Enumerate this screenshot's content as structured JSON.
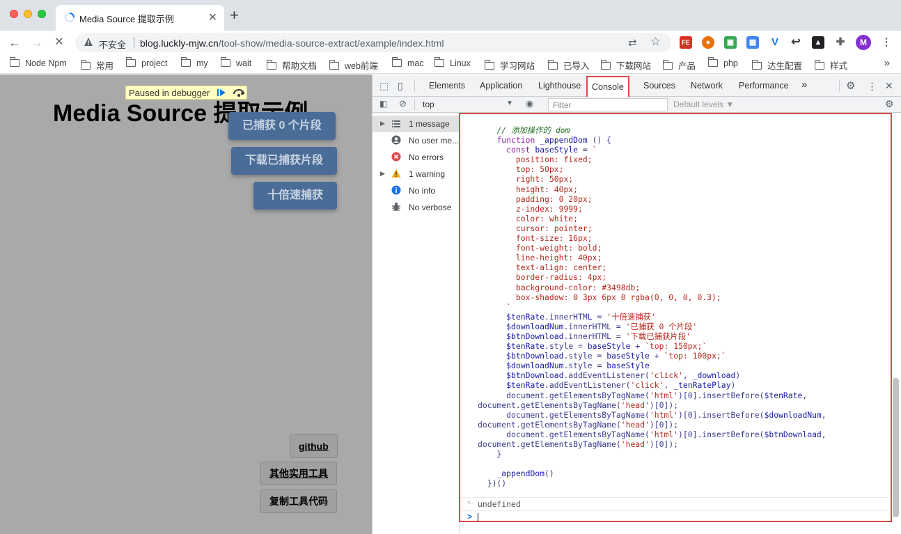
{
  "browser": {
    "tab_title": "Media Source 提取示例",
    "insecure_label": "不安全",
    "url_host": "blog.luckly-mjw.cn",
    "url_path": "/tool-show/media-source-extract/example/index.html",
    "profile_initial": "M",
    "extension_ie_label": "FE",
    "bookmarks": [
      "Node Npm",
      "常用",
      "project",
      "my",
      "wait",
      "帮助文档",
      "web前端",
      "mac",
      "Linux",
      "学习网站",
      "已导入",
      "下载网站",
      "产品",
      "php",
      "达生配置",
      "样式"
    ]
  },
  "page": {
    "paused_label": "Paused in debugger",
    "title": "Media Source 提取示例",
    "buttons": {
      "captured": "已捕获 0 个片段",
      "download": "下载已捕获片段",
      "ten_rate": "十倍速捕获"
    },
    "links": {
      "github": "github",
      "other_tools": "其他实用工具",
      "copy_code": "复制工具代码"
    },
    "accent_color": "#4a6d98"
  },
  "devtools": {
    "tabs": [
      "Elements",
      "Application",
      "Lighthouse",
      "Console",
      "Sources",
      "Network",
      "Performance"
    ],
    "active_tab": "Console",
    "more_tabs": "»",
    "context": "top",
    "filter_placeholder": "Filter",
    "levels": "Default levels ▼",
    "sidebar": [
      {
        "label": "1 message",
        "icon": "list-icon"
      },
      {
        "label": "No user me...",
        "icon": "user-icon"
      },
      {
        "label": "No errors",
        "icon": "error-icon"
      },
      {
        "label": "1 warning",
        "icon": "warning-icon"
      },
      {
        "label": "No info",
        "icon": "info-icon"
      },
      {
        "label": "No verbose",
        "icon": "bug-icon"
      }
    ],
    "result": "undefined",
    "highlight_color": "#e0474c"
  }
}
